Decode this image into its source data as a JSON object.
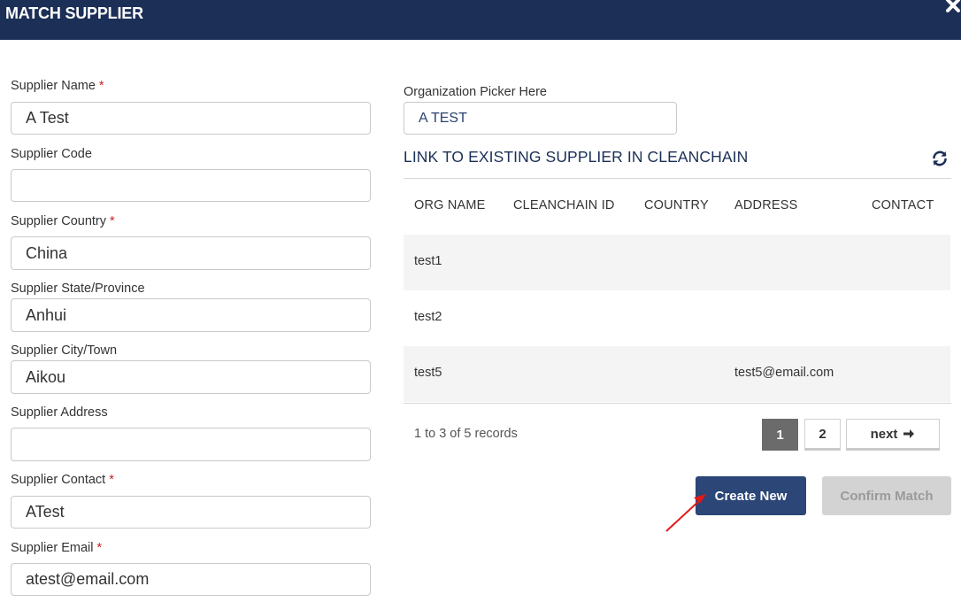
{
  "dialog": {
    "title": "MATCH SUPPLIER",
    "close_icon": "close-icon"
  },
  "form": {
    "required_marker": "*",
    "fields": [
      {
        "label": "Supplier Name",
        "value": "A Test",
        "required": true
      },
      {
        "label": "Supplier Code",
        "value": "",
        "required": false
      },
      {
        "label": "Supplier Country",
        "value": "China",
        "required": true
      },
      {
        "label": "Supplier State/Province",
        "value": "Anhui",
        "required": false
      },
      {
        "label": "Supplier City/Town",
        "value": "Aikou",
        "required": false
      },
      {
        "label": "Supplier Address",
        "value": "",
        "required": false
      },
      {
        "label": "Supplier Contact",
        "value": "ATest",
        "required": true
      },
      {
        "label": "Supplier Email",
        "value": "atest@email.com",
        "required": true
      }
    ]
  },
  "org_picker": {
    "label": "Organization Picker Here",
    "value": "A TEST"
  },
  "link_section": {
    "heading": "LINK TO EXISTING SUPPLIER IN CLEANCHAIN",
    "refresh_icon": "refresh-icon",
    "columns": [
      "ORG NAME",
      "CLEANCHAIN ID",
      "COUNTRY",
      "ADDRESS",
      "CONTACT"
    ],
    "rows": [
      {
        "org_name": "test1",
        "cleanchain_id": "",
        "country": "",
        "address": "",
        "contact": ""
      },
      {
        "org_name": "test2",
        "cleanchain_id": "",
        "country": "",
        "address": "",
        "contact": ""
      },
      {
        "org_name": "test5",
        "cleanchain_id": "",
        "country": "",
        "address": "test5@email.com",
        "contact": ""
      }
    ],
    "records_text": "1 to 3 of 5 records",
    "pagination": {
      "pages": [
        "1",
        "2"
      ],
      "current_page": 1,
      "next_label": "next",
      "next_icon": "arrow-right-icon"
    }
  },
  "actions": {
    "create_label": "Create New",
    "confirm_label": "Confirm Match"
  },
  "colors": {
    "header_bg": "#1b2f57",
    "primary_button": "#2b4677",
    "disabled_button": "#d3d3d3",
    "required_marker": "#cc2222",
    "annotation_arrow": "#e01818"
  }
}
